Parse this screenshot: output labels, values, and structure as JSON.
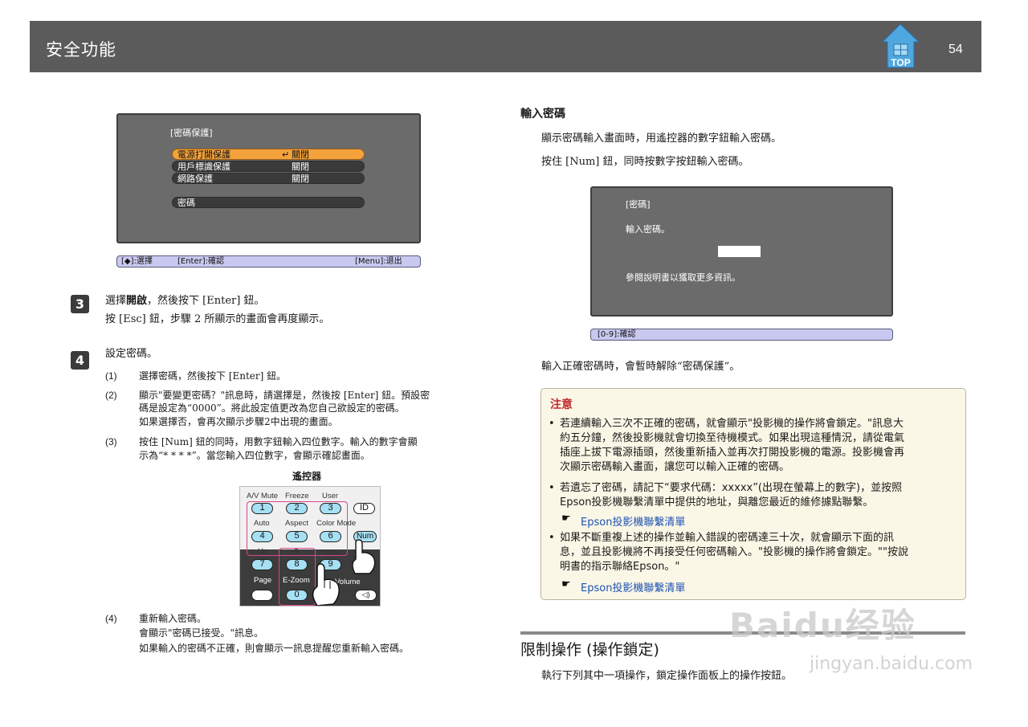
{
  "header": {
    "title": "安全功能",
    "page_number": "54",
    "top_label": "TOP"
  },
  "osd1": {
    "title": "[密碼保護]",
    "rows": [
      {
        "label": "電源打開保護",
        "value": "關閉",
        "selected": true
      },
      {
        "label": "用戶標識保護",
        "value": "關閉",
        "selected": false
      },
      {
        "label": "網路保護",
        "value": "關閉",
        "selected": false
      },
      {
        "label": "密碼",
        "value": "",
        "selected": false
      }
    ],
    "help": {
      "select": "[◆]:選擇",
      "enter": "[Enter]:確認",
      "exit": "[Menu]:退出"
    }
  },
  "step3": {
    "number": "3",
    "line1_pre": "選擇",
    "line1_bold": "開啟",
    "line1_post": "，然後按下 [Enter] 鈕。",
    "line2": "按 [Esc] 鈕，步驟 2 所顯示的畫面會再度顯示。"
  },
  "step4": {
    "number": "4",
    "title": "設定密碼。",
    "items": [
      {
        "num": "(1)",
        "lines": [
          "選擇密碼，然後按下 [Enter] 鈕。"
        ]
      },
      {
        "num": "(2)",
        "lines": [
          "顯示\"要變更密碼？\"訊息時，請選擇是，然後按 [Enter] 鈕。預設密",
          "碼是設定為“0000”。將此設定值更改為您自己欲設定的密碼。",
          "如果選擇否，會再次顯示步驟2中出現的畫面。"
        ]
      },
      {
        "num": "(3)",
        "lines": [
          "按住 [Num] 鈕的同時，用數字鈕輸入四位數字。輸入的數字會顯",
          "示為“* * * *”。當您輸入四位數字，會顯示確認畫面。"
        ]
      },
      {
        "num": "(4)",
        "lines": [
          "重新輸入密碼。",
          "會顯示\"密碼已接受。\"訊息。",
          "如果輸入的密碼不正確，則會顯示一訊息提醒您重新輸入密碼。"
        ]
      }
    ]
  },
  "remote": {
    "caption": "遙控器",
    "labels": [
      "A/V Mute",
      "Freeze",
      "User",
      "Auto",
      "Aspect",
      "Color Mode",
      "Up",
      "Pointer",
      "Page",
      "E-Zoom",
      "Volume"
    ],
    "keys": [
      "1",
      "2",
      "3",
      "4",
      "5",
      "6",
      "7",
      "8",
      "9",
      "0"
    ],
    "id_key": "ID",
    "num_key": "Num",
    "help_key": "Help"
  },
  "right": {
    "heading": "輸入密碼",
    "para1": "顯示密碼輸入畫面時，用遙控器的數字鈕輸入密碼。",
    "para2": "按住 [Num] 鈕，同時按數字按鈕輸入密碼。",
    "osd2": {
      "title": "[密碼]",
      "prompt": "輸入密碼。",
      "info": "參閱說明書以獲取更多資訊。",
      "help": "[0-9]:確認"
    },
    "after": "輸入正確密碼時，會暫時解除“密碼保護”。"
  },
  "note": {
    "title": "注意",
    "bullet1": [
      "若連續輸入三次不正確的密碼，就會顯示\"投影機的操作將會鎖定。\"訊息大",
      "約五分鐘，然後投影機就會切換至待機模式。如果出現這種情況，請從電氣",
      "插座上拔下電源插頭，然後重新插入並再次打開投影機的電源。投影機會再",
      "次顯示密碼輸入畫面，讓您可以輸入正確的密碼。"
    ],
    "bullet2": [
      "若遺忘了密碼，請記下“要求代碼：xxxxx”(出現在螢幕上的數字)，並按照",
      "Epson投影機聯繫清單中提供的地址，與離您最近的維修據點聯繫。"
    ],
    "link1": "Epson投影機聯繫清單",
    "bullet3": [
      "如果不斷重複上述的操作並輸入錯誤的密碼達三十次，就會顯示下面的訊",
      "息，並且投影機將不再接受任何密碼輸入。\"投影機的操作將會鎖定。\"\"按說",
      "明書的指示聯絡Epson。\""
    ],
    "link2": "Epson投影機聯繫清單"
  },
  "section": {
    "title": "限制操作 (操作鎖定)",
    "body": "執行下列其中一項操作，鎖定操作面板上的操作按鈕。"
  },
  "watermark": {
    "main": "Baidu经验",
    "sub": "jingyan.baidu.com"
  }
}
